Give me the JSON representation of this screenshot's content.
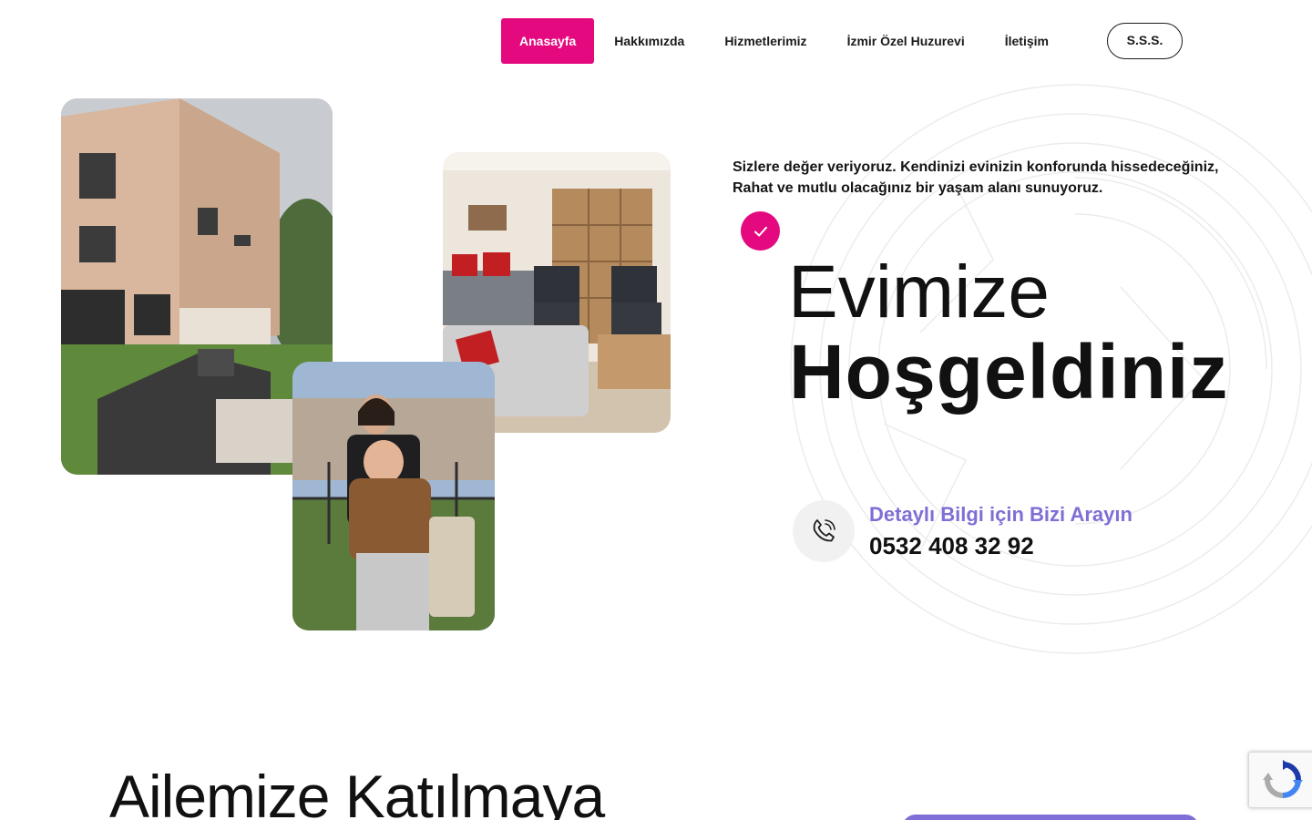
{
  "nav": {
    "items": [
      {
        "label": "Anasayfa",
        "active": true
      },
      {
        "label": "Hakkımızda",
        "active": false
      },
      {
        "label": "Hizmetlerimiz",
        "active": false
      },
      {
        "label": "İzmir Özel Huzurevi",
        "active": false
      },
      {
        "label": "İletişim",
        "active": false
      }
    ],
    "sss_label": "S.S.S."
  },
  "hero": {
    "intro_line1": "Sizlere değer veriyoruz. Kendinizi evinizin konforunda hissedeceğiniz,",
    "intro_line2": "Rahat ve mutlu olacağınız bir yaşam alanı sunuyoruz.",
    "title_light": "Evimize",
    "title_bold": "Hoşgeldiniz"
  },
  "contact": {
    "caption": "Detaylı Bilgi için Bizi Arayın",
    "phone": "0532 408 32 92",
    "icon": "phone-icon"
  },
  "section2": {
    "title": "Ailemize Katılmaya"
  },
  "colors": {
    "accent_pink": "#e4097f",
    "accent_purple": "#7e6fd6",
    "text_dark": "#111111"
  }
}
